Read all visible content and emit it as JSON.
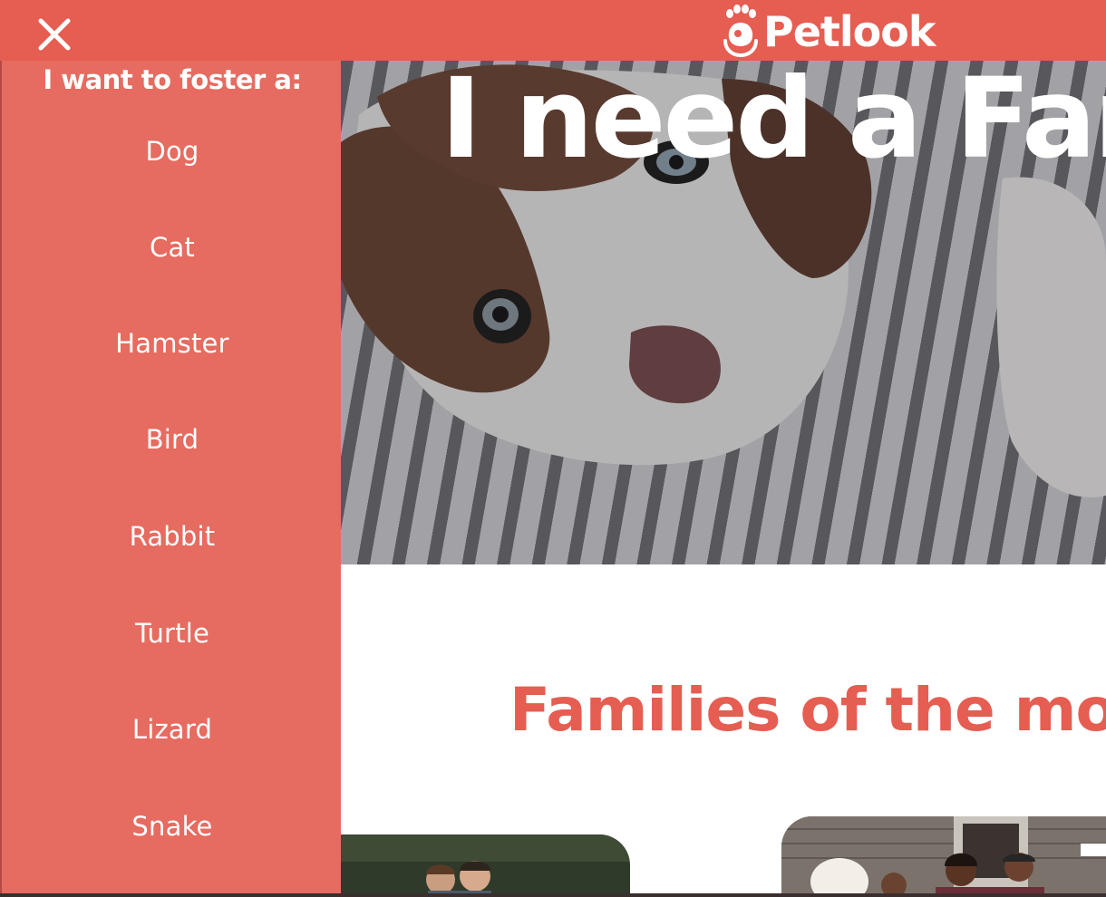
{
  "header": {
    "brand_name": "Petlook",
    "brand_color": "#e65d52",
    "close_icon": "close-icon",
    "logo_icon": "paw-heart-hands-icon"
  },
  "sidebar": {
    "heading": "I want to foster a:",
    "background": "#e66b60",
    "items": [
      {
        "label": "Dog"
      },
      {
        "label": "Cat"
      },
      {
        "label": "Hamster"
      },
      {
        "label": "Bird"
      },
      {
        "label": "Rabbit"
      },
      {
        "label": "Turtle"
      },
      {
        "label": "Lizard"
      },
      {
        "label": "Snake"
      }
    ]
  },
  "hero": {
    "title": "I need a Fam",
    "image": "puppy-on-striped-blanket"
  },
  "families": {
    "title": "Families of the mor",
    "cards": [
      {
        "image": "family-photo-outdoors"
      },
      {
        "image": "family-photo-with-dog-porch"
      }
    ]
  }
}
